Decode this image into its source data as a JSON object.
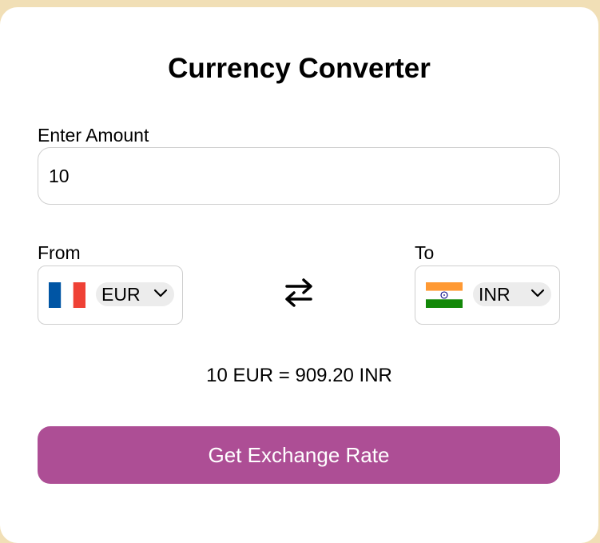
{
  "app": {
    "title": "Currency Converter"
  },
  "amount": {
    "label": "Enter Amount",
    "value": "10"
  },
  "from": {
    "label": "From",
    "currency": "EUR",
    "flag_icon": "france-flag-icon"
  },
  "to": {
    "label": "To",
    "currency": "INR",
    "flag_icon": "india-flag-icon"
  },
  "swap_icon": "swap-arrows-icon",
  "result": {
    "text": "10 EUR = 909.20 INR"
  },
  "button": {
    "label": "Get Exchange Rate"
  },
  "colors": {
    "background": "#f1dfb6",
    "button": "#ad4e95",
    "border": "#cfcfcf"
  }
}
